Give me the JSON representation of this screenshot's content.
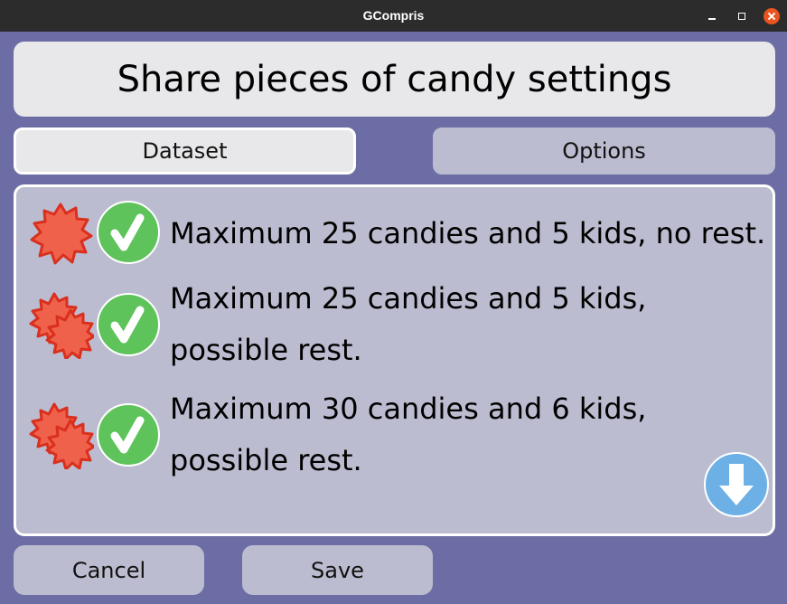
{
  "window": {
    "title": "GCompris"
  },
  "header": {
    "title": "Share pieces of candy settings"
  },
  "tabs": [
    {
      "label": "Dataset",
      "active": true
    },
    {
      "label": "Options",
      "active": false
    }
  ],
  "datasets": [
    {
      "label": "Maximum 25 candies and 5 kids, no rest.",
      "icon": "single-candy-icon",
      "selected": true
    },
    {
      "label": "Maximum 25 candies and 5 kids, possible rest.",
      "icon": "double-candy-icon",
      "selected": true
    },
    {
      "label": "Maximum 30 candies and 6 kids, possible rest.",
      "icon": "double-candy-icon",
      "selected": true
    }
  ],
  "footer": {
    "cancel_label": "Cancel",
    "save_label": "Save"
  },
  "colors": {
    "background": "#6b6da4",
    "panel": "#bcbcd0",
    "header": "#e8e8ea",
    "check": "#5ec35a",
    "candy": "#f0614b",
    "candy_outline": "#d9301e",
    "scroll_button": "#6cb0e6",
    "close_button": "#e95420"
  }
}
